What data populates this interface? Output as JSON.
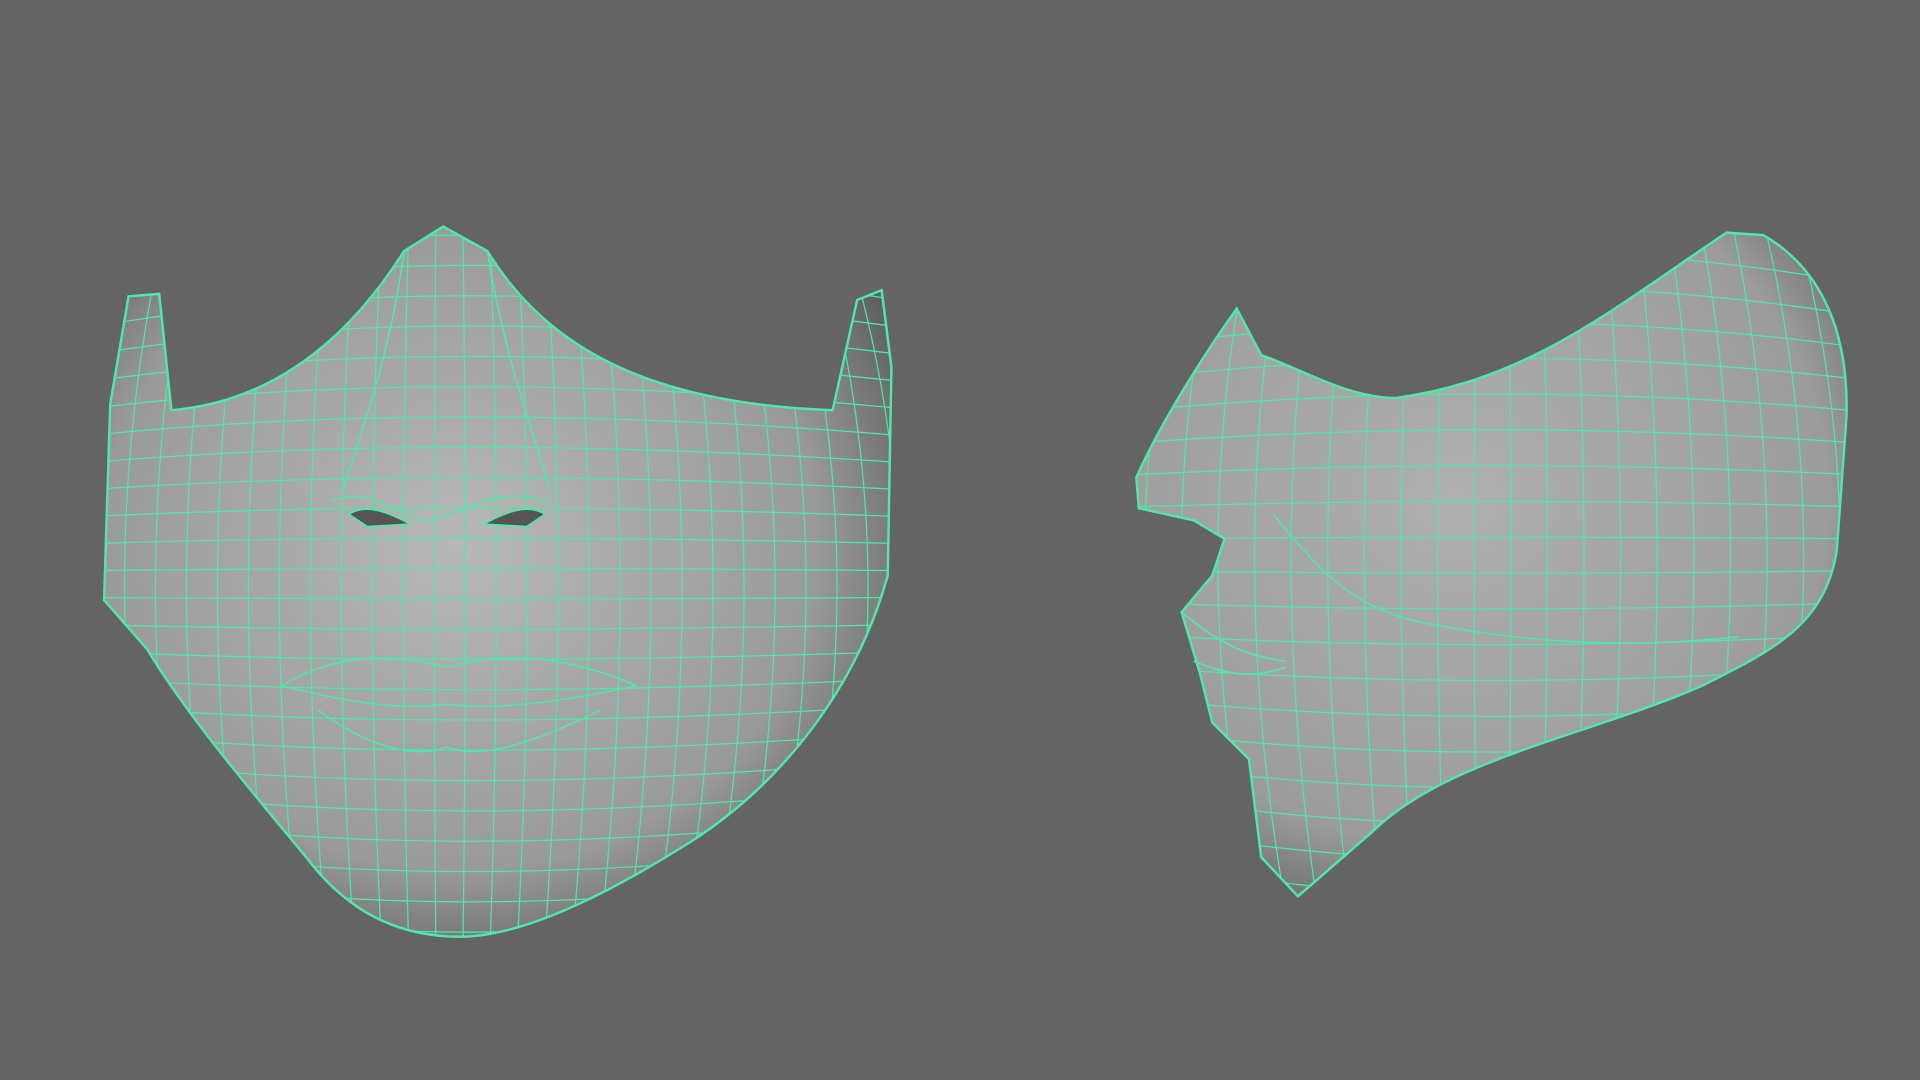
{
  "colors": {
    "background": "#646464",
    "wireframe": "#4fe8aa",
    "surface_light": "#b4b4b4",
    "surface_dark": "#3a3a3a"
  }
}
